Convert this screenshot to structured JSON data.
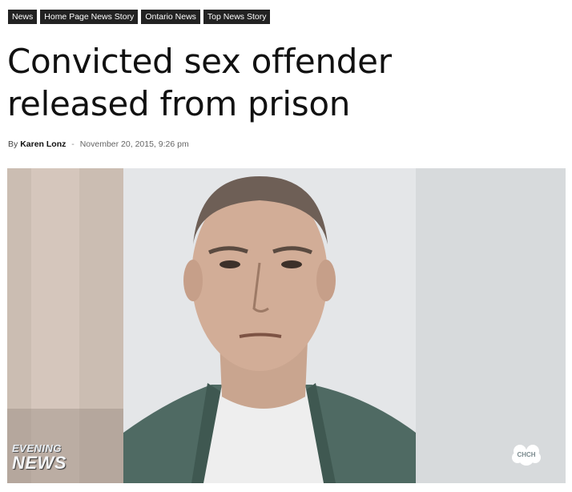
{
  "categories": [
    "News",
    "Home Page News Story",
    "Ontario News",
    "Top News Story"
  ],
  "article": {
    "title": "Convicted sex offender released from prison",
    "by_label": "By",
    "author": "Karen Lonz",
    "separator": "-",
    "date": "November 20, 2015, 9:26 pm"
  },
  "image": {
    "watermark_line1": "EVENING",
    "watermark_line2": "NEWS",
    "logo_text": "CHCH"
  }
}
